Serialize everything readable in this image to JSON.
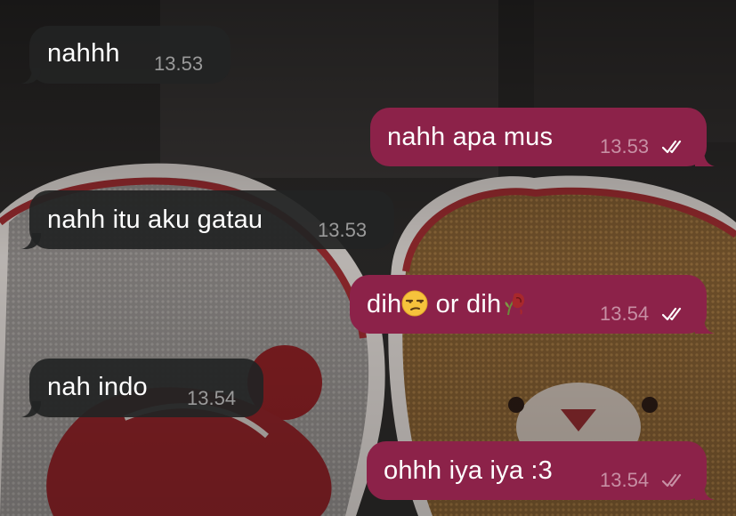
{
  "messages": [
    {
      "text": "nahhh",
      "time": "13.53",
      "direction": "incoming"
    },
    {
      "text": "nahh apa mus",
      "time": "13.53",
      "direction": "outgoing",
      "status": "read",
      "status_icon": "double-check-icon"
    },
    {
      "text": "nahh itu aku gatau",
      "time": "13.53",
      "direction": "incoming"
    },
    {
      "text_parts": [
        "dih",
        "unamused-face-emoji",
        " or dih",
        "wilted-rose-emoji"
      ],
      "text_1": "dih",
      "text_2": " or dih",
      "time": "13.54",
      "direction": "outgoing",
      "status": "read",
      "status_icon": "double-check-icon"
    },
    {
      "text": "nah indo",
      "time": "13.54",
      "direction": "incoming"
    },
    {
      "text": "ohhh iya iya :3",
      "time": "13.54",
      "direction": "outgoing",
      "status": "delivered",
      "status_icon": "double-check-icon"
    }
  ],
  "colors": {
    "incoming_bubble": "#222324",
    "outgoing_bubble": "#8c2249",
    "text": "#ffffff",
    "incoming_time": "#9a9a9a",
    "outgoing_time": "#c78fa4"
  }
}
